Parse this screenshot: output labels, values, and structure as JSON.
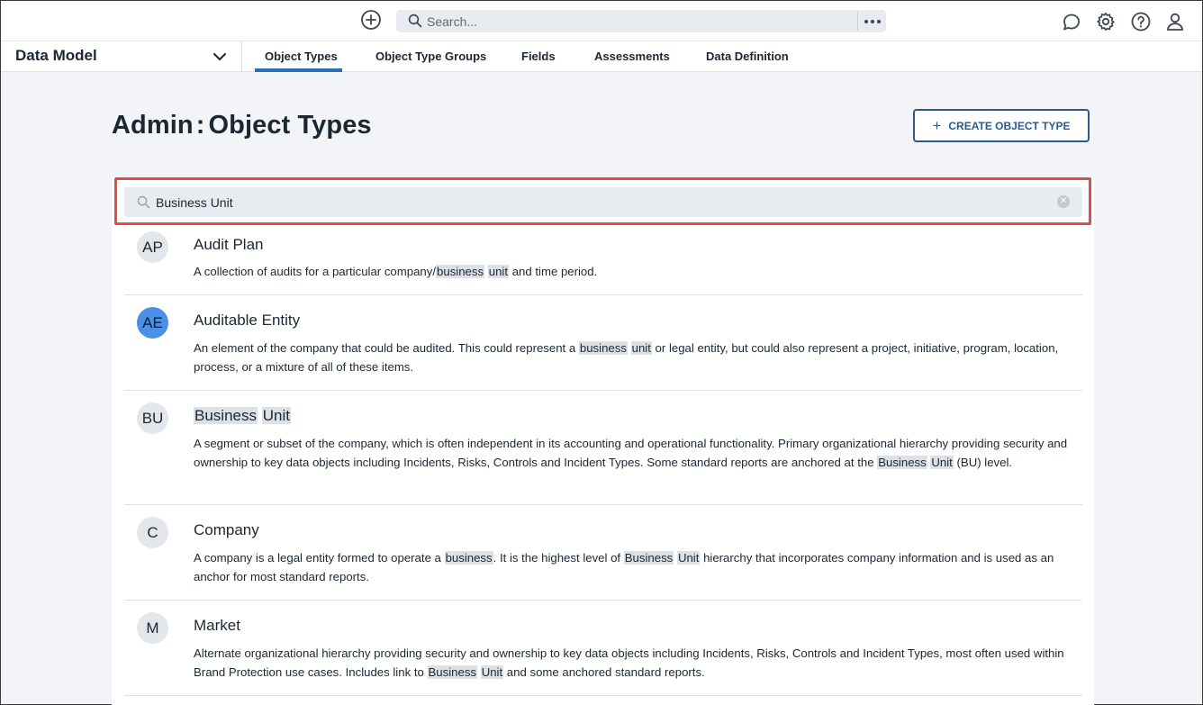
{
  "topbar": {
    "search_placeholder": "Search...",
    "icons": [
      "add-circle-icon",
      "search-icon",
      "more-icon",
      "chat-icon",
      "gear-icon",
      "help-icon",
      "user-icon"
    ]
  },
  "app": {
    "title": "Data Model"
  },
  "tabs": [
    {
      "label": "Object Types",
      "active": true
    },
    {
      "label": "Object Type Groups",
      "active": false
    },
    {
      "label": "Fields",
      "active": false
    },
    {
      "label": "Assessments",
      "active": false
    },
    {
      "label": "Data Definition",
      "active": false
    }
  ],
  "page": {
    "title_prefix": "Admin",
    "title_sep": ":",
    "title_main": "Object Types",
    "create_label": "CREATE OBJECT TYPE"
  },
  "filter": {
    "value": "Business Unit"
  },
  "colors": {
    "accent": "#2c5a8c",
    "active_tab": "#2c6fb7",
    "highlight_border": "#e34b4b",
    "avatar_blue": "#4a8fe8"
  },
  "items": [
    {
      "initials": "AP",
      "title": "Audit Plan",
      "desc": [
        {
          "t": "A collection of audits for a particular company/"
        },
        {
          "t": "business",
          "m": true
        },
        {
          "t": " "
        },
        {
          "t": "unit",
          "m": true
        },
        {
          "t": " and time period."
        }
      ]
    },
    {
      "initials": "AE",
      "title": "Auditable Entity",
      "desc": [
        {
          "t": "An element of the company that could be audited. This could represent a "
        },
        {
          "t": "business",
          "m": true
        },
        {
          "t": " "
        },
        {
          "t": "unit",
          "m": true
        },
        {
          "t": " or legal entity, but could also represent a project, initiative, program, location, process, or a mixture of all of these items."
        }
      ]
    },
    {
      "initials": "BU",
      "title_parts": [
        {
          "t": "Business",
          "m": true
        },
        {
          "t": " "
        },
        {
          "t": "Unit",
          "m": true
        }
      ],
      "desc": [
        {
          "t": "A segment or subset of the company, which is often independent in its accounting and operational functionality. Primary organizational hierarchy providing security and ownership to key data objects including Incidents, Risks, Controls and Incident Types. Some standard reports are anchored at the "
        },
        {
          "t": "Business",
          "m": true
        },
        {
          "t": " "
        },
        {
          "t": "Unit",
          "m": true
        },
        {
          "t": " (BU) level."
        }
      ]
    },
    {
      "initials": "C",
      "title": "Company",
      "desc": [
        {
          "t": "A company is a legal entity formed to operate a "
        },
        {
          "t": "business",
          "m": true
        },
        {
          "t": ". It is the highest level of "
        },
        {
          "t": "Business",
          "m": true
        },
        {
          "t": " "
        },
        {
          "t": "Unit",
          "m": true
        },
        {
          "t": " hierarchy that incorporates company information and is used as an anchor for most standard reports."
        }
      ]
    },
    {
      "initials": "M",
      "title": "Market",
      "desc": [
        {
          "t": "Alternate organizational hierarchy providing security and ownership to key data objects including Incidents, Risks, Controls and Incident Types, most often used within Brand Protection use cases. Includes link to "
        },
        {
          "t": "Business",
          "m": true
        },
        {
          "t": " "
        },
        {
          "t": "Unit",
          "m": true
        },
        {
          "t": " and some anchored standard reports."
        }
      ]
    }
  ]
}
